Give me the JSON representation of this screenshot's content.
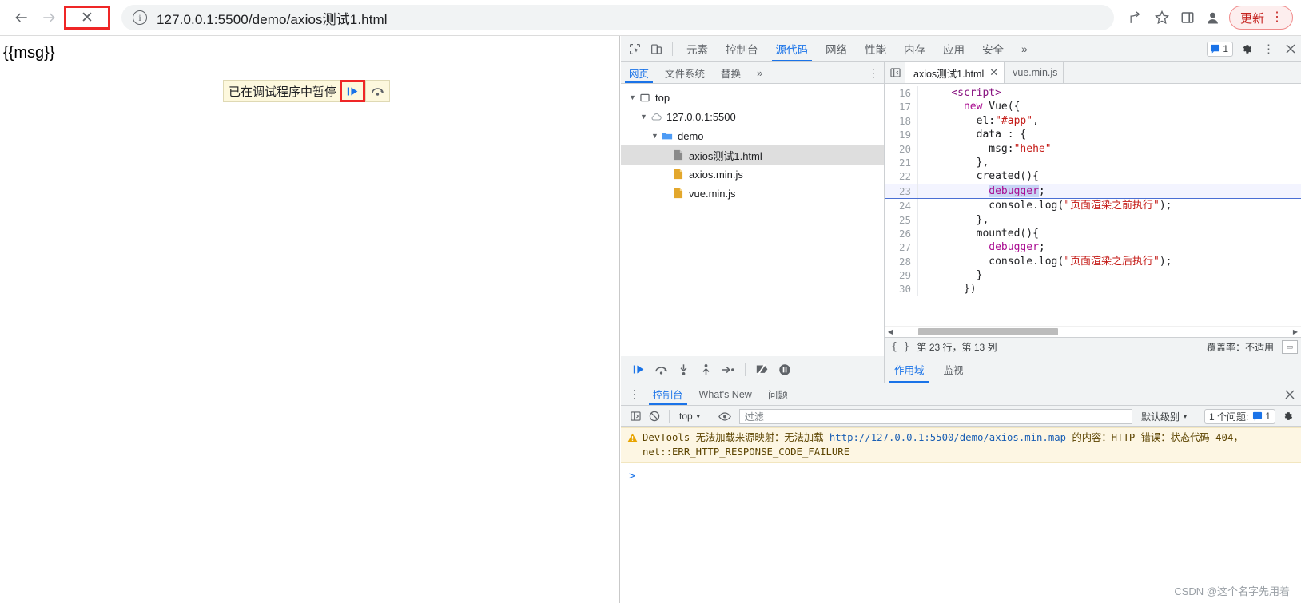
{
  "browser": {
    "back_icon": "arrow-left-icon",
    "forward_icon": "arrow-right-icon",
    "stop_label": "✕",
    "site_info_icon": "info-circle-icon",
    "url": "127.0.0.1:5500/demo/axios测试1.html",
    "share_icon": "share-icon",
    "bookmark_icon": "star-icon",
    "sidepanel_icon": "side-panel-icon",
    "profile_icon": "avatar-icon",
    "update_label": "更新",
    "menu_icon": "kebab-menu-icon",
    "highlight_color": "#ef2626",
    "update_color": "#c5221f"
  },
  "page": {
    "content": "{{msg}}",
    "paused_banner": {
      "text": "已在调试程序中暂停",
      "resume_icon": "resume-script-icon",
      "step_icon": "step-over-icon"
    }
  },
  "devtools": {
    "inspect_icon": "inspect-element-icon",
    "device_icon": "device-toolbar-icon",
    "tabs": [
      {
        "label": "元素",
        "active": false
      },
      {
        "label": "控制台",
        "active": false
      },
      {
        "label": "源代码",
        "active": true
      },
      {
        "label": "网络",
        "active": false
      },
      {
        "label": "性能",
        "active": false
      },
      {
        "label": "内存",
        "active": false
      },
      {
        "label": "应用",
        "active": false
      },
      {
        "label": "安全",
        "active": false
      }
    ],
    "more_tabs_icon": "chevron-double-right-icon",
    "message_count": "1",
    "settings_icon": "gear-icon",
    "kebab_icon": "kebab-menu-icon",
    "close_icon": "close-icon",
    "accent_color": "#1a73e8"
  },
  "navigator": {
    "tabs": [
      {
        "label": "网页",
        "active": true
      },
      {
        "label": "文件系统",
        "active": false
      },
      {
        "label": "替换",
        "active": false
      }
    ],
    "more_icon": "chevron-double-right-icon",
    "kebab_icon": "kebab-menu-icon",
    "tree": [
      {
        "label": "top",
        "icon": "frame-icon",
        "indent": 0,
        "expanded": true,
        "selected": false
      },
      {
        "label": "127.0.0.1:5500",
        "icon": "cloud-icon",
        "indent": 1,
        "expanded": true,
        "selected": false
      },
      {
        "label": "demo",
        "icon": "folder-icon",
        "indent": 2,
        "expanded": true,
        "selected": false
      },
      {
        "label": "axios测试1.html",
        "icon": "document-icon",
        "indent": 3,
        "expanded": false,
        "selected": true
      },
      {
        "label": "axios.min.js",
        "icon": "script-file-icon",
        "indent": 3,
        "expanded": false,
        "selected": false
      },
      {
        "label": "vue.min.js",
        "icon": "script-file-icon",
        "indent": 3,
        "expanded": false,
        "selected": false
      }
    ]
  },
  "editor": {
    "collapse_icon": "collapse-sidebar-icon",
    "tabs": [
      {
        "label": "axios测试1.html",
        "active": true,
        "close": "✕"
      },
      {
        "label": "vue.min.js",
        "active": false,
        "close": ""
      }
    ],
    "lines": [
      {
        "num": "16",
        "indent": 2,
        "current": false,
        "tokens": [
          {
            "t": "<script>",
            "c": "k-tag"
          }
        ]
      },
      {
        "num": "17",
        "indent": 3,
        "current": false,
        "tokens": [
          {
            "t": "new ",
            "c": "k-kw2"
          },
          {
            "t": "Vue({",
            "c": "k-fn"
          }
        ]
      },
      {
        "num": "18",
        "indent": 4,
        "current": false,
        "tokens": [
          {
            "t": "el:",
            "c": "k-fn"
          },
          {
            "t": "\"#app\"",
            "c": "k-str"
          },
          {
            "t": ",",
            "c": "k-fn"
          }
        ]
      },
      {
        "num": "19",
        "indent": 4,
        "current": false,
        "tokens": [
          {
            "t": "data : {",
            "c": "k-fn"
          }
        ]
      },
      {
        "num": "20",
        "indent": 5,
        "current": false,
        "tokens": [
          {
            "t": "msg:",
            "c": "k-fn"
          },
          {
            "t": "\"hehe\"",
            "c": "k-str"
          }
        ]
      },
      {
        "num": "21",
        "indent": 4,
        "current": false,
        "tokens": [
          {
            "t": "},",
            "c": "k-fn"
          }
        ]
      },
      {
        "num": "22",
        "indent": 4,
        "current": false,
        "tokens": [
          {
            "t": "created(){",
            "c": "k-fn"
          }
        ]
      },
      {
        "num": "23",
        "indent": 5,
        "current": true,
        "tokens": [
          {
            "t": "debugger",
            "c": "k-sel"
          },
          {
            "t": ";",
            "c": "k-fn"
          }
        ]
      },
      {
        "num": "24",
        "indent": 5,
        "current": false,
        "tokens": [
          {
            "t": "console.log(",
            "c": "k-fn"
          },
          {
            "t": "\"页面渲染之前执行\"",
            "c": "k-str"
          },
          {
            "t": ");",
            "c": "k-fn"
          }
        ]
      },
      {
        "num": "25",
        "indent": 4,
        "current": false,
        "tokens": [
          {
            "t": "},",
            "c": "k-fn"
          }
        ]
      },
      {
        "num": "26",
        "indent": 4,
        "current": false,
        "tokens": [
          {
            "t": "mounted(){",
            "c": "k-fn"
          }
        ]
      },
      {
        "num": "27",
        "indent": 5,
        "current": false,
        "tokens": [
          {
            "t": "debugger",
            "c": "k-kw2"
          },
          {
            "t": ";",
            "c": "k-fn"
          }
        ]
      },
      {
        "num": "28",
        "indent": 5,
        "current": false,
        "tokens": [
          {
            "t": "console.log(",
            "c": "k-fn"
          },
          {
            "t": "\"页面渲染之后执行\"",
            "c": "k-str"
          },
          {
            "t": ");",
            "c": "k-fn"
          }
        ]
      },
      {
        "num": "29",
        "indent": 4,
        "current": false,
        "tokens": [
          {
            "t": "}",
            "c": "k-fn"
          }
        ]
      },
      {
        "num": "30",
        "indent": 3,
        "current": false,
        "tokens": [
          {
            "t": "})",
            "c": "k-fn"
          }
        ]
      }
    ],
    "status": {
      "format_icon": "pretty-print-braces-icon",
      "cursor": "第 23 行，第 13 列",
      "coverage": "覆盖率：不适用",
      "popout_icon": "popout-icon"
    },
    "scroll_left_arrow": "◀",
    "scroll_right_arrow": "▶"
  },
  "debugger": {
    "controls": [
      {
        "name": "resume-script-icon",
        "active": true
      },
      {
        "name": "step-over-icon",
        "active": false
      },
      {
        "name": "step-into-icon",
        "active": false
      },
      {
        "name": "step-out-icon",
        "active": false
      },
      {
        "name": "step-icon",
        "active": false
      },
      {
        "name": "deactivate-breakpoints-icon",
        "active": false
      },
      {
        "name": "pause-on-exceptions-icon",
        "active": false
      }
    ],
    "side_tabs": [
      {
        "label": "作用域",
        "active": true
      },
      {
        "label": "监视",
        "active": false
      }
    ]
  },
  "drawer": {
    "kebab_icon": "kebab-menu-icon",
    "tabs": [
      {
        "label": "控制台",
        "active": true
      },
      {
        "label": "What's New",
        "active": false
      },
      {
        "label": "问题",
        "active": false
      }
    ],
    "close_icon": "close-icon",
    "toolbar": {
      "sidebar_icon": "console-sidebar-icon",
      "clear_icon": "clear-console-icon",
      "context": "top",
      "context_caret": "▾",
      "eye_icon": "live-expression-icon",
      "filter_placeholder": "过滤",
      "level": "默认级别",
      "level_caret": "▾",
      "issues_label": "1 个问题:",
      "issues_count": "1",
      "settings_icon": "gear-icon"
    },
    "messages": [
      {
        "type": "warning",
        "icon": "warning-triangle-icon",
        "prefix": "DevTools 无法加载来源映射：无法加载 ",
        "link": "http://127.0.0.1:5500/demo/axios.min.map",
        "suffix": " 的内容：HTTP 错误：状态代码 404，net::ERR_HTTP_RESPONSE_CODE_FAILURE"
      }
    ],
    "prompt": ">"
  },
  "watermark": "CSDN @这个名字先用着"
}
